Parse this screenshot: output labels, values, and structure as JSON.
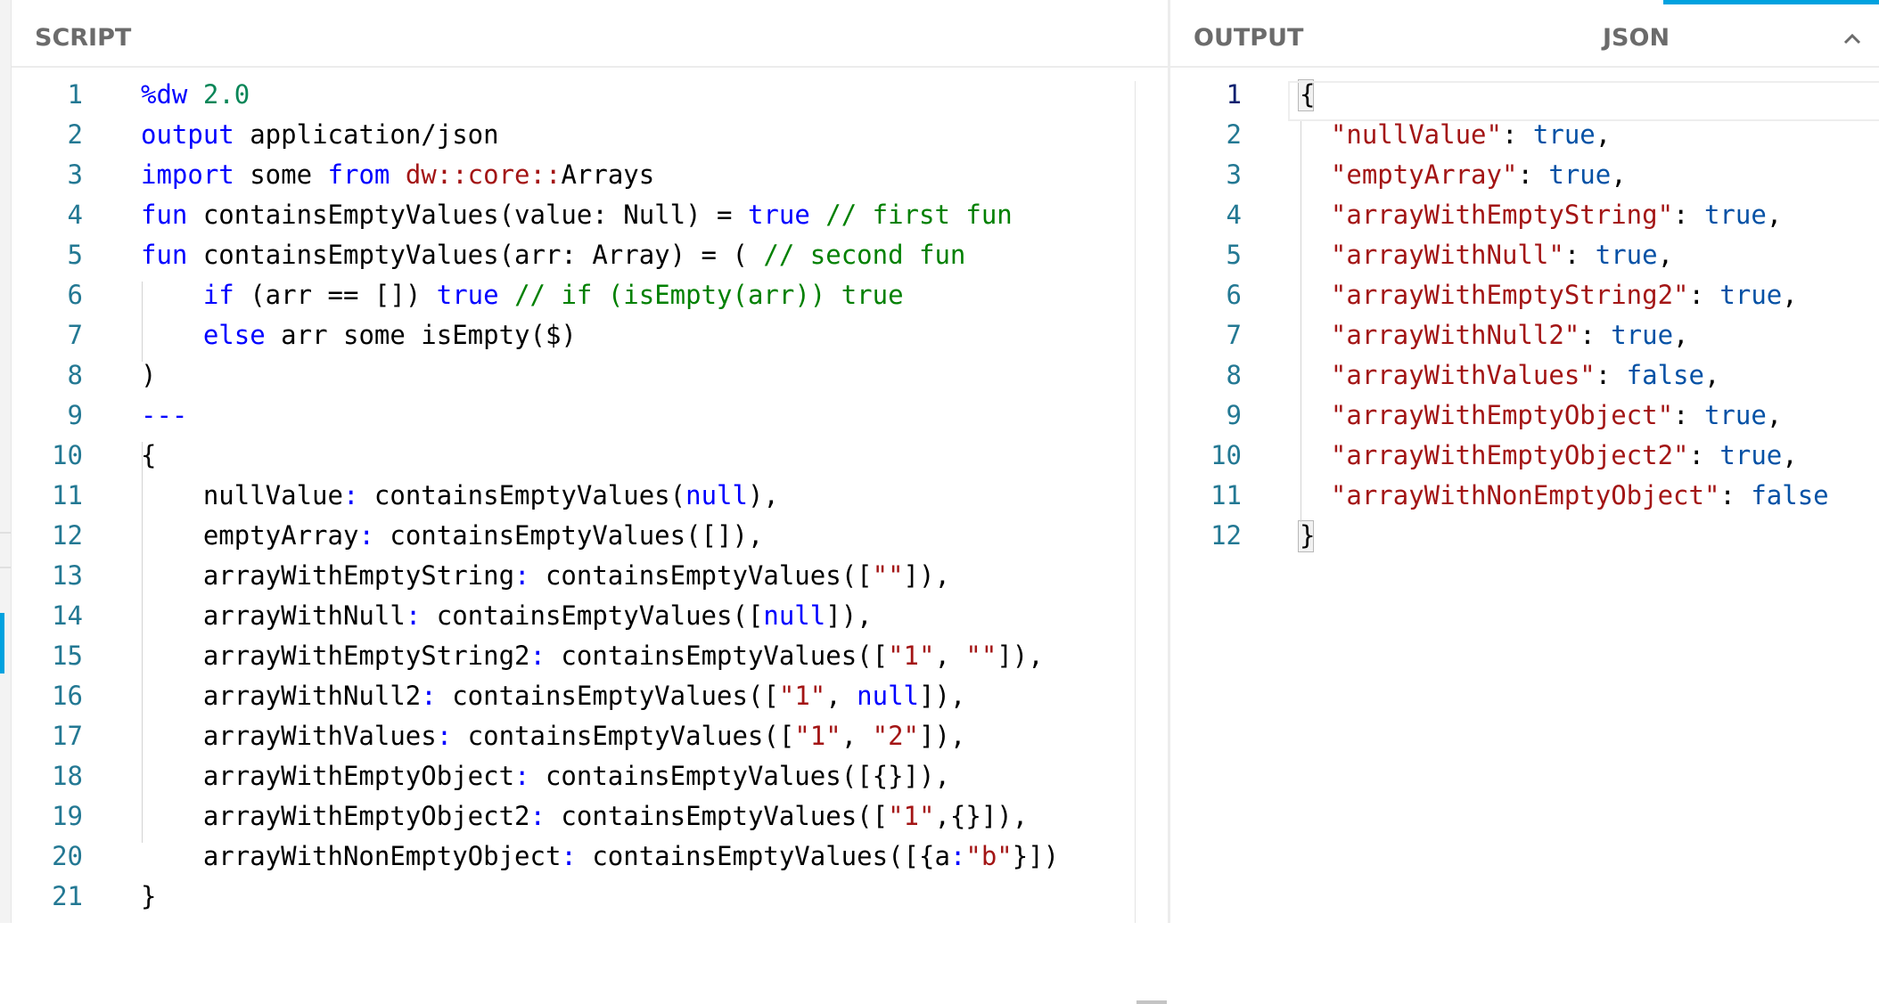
{
  "script_panel": {
    "title": "SCRIPT",
    "lines": [
      {
        "n": "1",
        "segs": [
          [
            "kw",
            "%dw"
          ],
          [
            "",
            " "
          ],
          [
            "num",
            "2.0"
          ]
        ]
      },
      {
        "n": "2",
        "segs": [
          [
            "kw",
            "output"
          ],
          [
            "",
            " application/json"
          ]
        ]
      },
      {
        "n": "3",
        "segs": [
          [
            "kw",
            "import"
          ],
          [
            "",
            " some "
          ],
          [
            "kw",
            "from"
          ],
          [
            "",
            " "
          ],
          [
            "ns",
            "dw::core::"
          ],
          [
            "",
            "Arrays"
          ]
        ]
      },
      {
        "n": "4",
        "segs": [
          [
            "kw",
            "fun"
          ],
          [
            "",
            " containsEmptyValues(value: Null) = "
          ],
          [
            "kw",
            "true"
          ],
          [
            "",
            " "
          ],
          [
            "cm",
            "// first fun"
          ]
        ]
      },
      {
        "n": "5",
        "segs": [
          [
            "kw",
            "fun"
          ],
          [
            "",
            " containsEmptyValues(arr: Array) = ( "
          ],
          [
            "cm",
            "// second fun"
          ]
        ]
      },
      {
        "n": "6",
        "segs": [
          [
            "",
            "    "
          ],
          [
            "kw",
            "if"
          ],
          [
            "",
            " (arr == []) "
          ],
          [
            "kw",
            "true"
          ],
          [
            "",
            " "
          ],
          [
            "cm",
            "// if (isEmpty(arr)) true"
          ]
        ]
      },
      {
        "n": "7",
        "segs": [
          [
            "",
            "    "
          ],
          [
            "kw",
            "else"
          ],
          [
            "",
            " arr some isEmpty($)"
          ]
        ]
      },
      {
        "n": "8",
        "segs": [
          [
            "",
            ")"
          ]
        ]
      },
      {
        "n": "9",
        "segs": [
          [
            "kw",
            "---"
          ]
        ]
      },
      {
        "n": "10",
        "segs": [
          [
            "",
            "{"
          ]
        ]
      },
      {
        "n": "11",
        "segs": [
          [
            "",
            "    nullValue"
          ],
          [
            "sep",
            ":"
          ],
          [
            "",
            " containsEmptyValues("
          ],
          [
            "kw",
            "null"
          ],
          [
            "",
            "),"
          ]
        ]
      },
      {
        "n": "12",
        "segs": [
          [
            "",
            "    emptyArray"
          ],
          [
            "sep",
            ":"
          ],
          [
            "",
            " containsEmptyValues([]),"
          ]
        ]
      },
      {
        "n": "13",
        "segs": [
          [
            "",
            "    arrayWithEmptyString"
          ],
          [
            "sep",
            ":"
          ],
          [
            "",
            " containsEmptyValues(["
          ],
          [
            "str",
            "\"\""
          ],
          [
            "",
            "]),"
          ]
        ]
      },
      {
        "n": "14",
        "segs": [
          [
            "",
            "    arrayWithNull"
          ],
          [
            "sep",
            ":"
          ],
          [
            "",
            " containsEmptyValues(["
          ],
          [
            "kw",
            "null"
          ],
          [
            "",
            "]),"
          ]
        ]
      },
      {
        "n": "15",
        "segs": [
          [
            "",
            "    arrayWithEmptyString2"
          ],
          [
            "sep",
            ":"
          ],
          [
            "",
            " containsEmptyValues(["
          ],
          [
            "str",
            "\"1\""
          ],
          [
            "",
            ", "
          ],
          [
            "str",
            "\"\""
          ],
          [
            "",
            "]),"
          ]
        ]
      },
      {
        "n": "16",
        "segs": [
          [
            "",
            "    arrayWithNull2"
          ],
          [
            "sep",
            ":"
          ],
          [
            "",
            " containsEmptyValues(["
          ],
          [
            "str",
            "\"1\""
          ],
          [
            "",
            ", "
          ],
          [
            "kw",
            "null"
          ],
          [
            "",
            "]),"
          ]
        ]
      },
      {
        "n": "17",
        "segs": [
          [
            "",
            "    arrayWithValues"
          ],
          [
            "sep",
            ":"
          ],
          [
            "",
            " containsEmptyValues(["
          ],
          [
            "str",
            "\"1\""
          ],
          [
            "",
            ", "
          ],
          [
            "str",
            "\"2\""
          ],
          [
            "",
            "]),"
          ]
        ]
      },
      {
        "n": "18",
        "segs": [
          [
            "",
            "    arrayWithEmptyObject"
          ],
          [
            "sep",
            ":"
          ],
          [
            "",
            " containsEmptyValues([{}]),"
          ]
        ]
      },
      {
        "n": "19",
        "segs": [
          [
            "",
            "    arrayWithEmptyObject2"
          ],
          [
            "sep",
            ":"
          ],
          [
            "",
            " containsEmptyValues(["
          ],
          [
            "str",
            "\"1\""
          ],
          [
            "",
            ",{}]),"
          ]
        ]
      },
      {
        "n": "20",
        "segs": [
          [
            "",
            "    arrayWithNonEmptyObject"
          ],
          [
            "sep",
            ":"
          ],
          [
            "",
            " containsEmptyValues([{a"
          ],
          [
            "sep",
            ":"
          ],
          [
            "str",
            "\"b\""
          ],
          [
            "",
            "}])"
          ]
        ]
      },
      {
        "n": "21",
        "segs": [
          [
            "",
            "}"
          ]
        ]
      }
    ]
  },
  "output_panel": {
    "title": "OUTPUT",
    "format": "JSON",
    "lines": [
      {
        "n": "1",
        "segs": [
          [
            "",
            "{"
          ]
        ]
      },
      {
        "n": "2",
        "segs": [
          [
            "",
            "  "
          ],
          [
            "jkey",
            "\"nullValue\""
          ],
          [
            "",
            ": "
          ],
          [
            "jval",
            "true"
          ],
          [
            "",
            ","
          ]
        ]
      },
      {
        "n": "3",
        "segs": [
          [
            "",
            "  "
          ],
          [
            "jkey",
            "\"emptyArray\""
          ],
          [
            "",
            ": "
          ],
          [
            "jval",
            "true"
          ],
          [
            "",
            ","
          ]
        ]
      },
      {
        "n": "4",
        "segs": [
          [
            "",
            "  "
          ],
          [
            "jkey",
            "\"arrayWithEmptyString\""
          ],
          [
            "",
            ": "
          ],
          [
            "jval",
            "true"
          ],
          [
            "",
            ","
          ]
        ]
      },
      {
        "n": "5",
        "segs": [
          [
            "",
            "  "
          ],
          [
            "jkey",
            "\"arrayWithNull\""
          ],
          [
            "",
            ": "
          ],
          [
            "jval",
            "true"
          ],
          [
            "",
            ","
          ]
        ]
      },
      {
        "n": "6",
        "segs": [
          [
            "",
            "  "
          ],
          [
            "jkey",
            "\"arrayWithEmptyString2\""
          ],
          [
            "",
            ": "
          ],
          [
            "jval",
            "true"
          ],
          [
            "",
            ","
          ]
        ]
      },
      {
        "n": "7",
        "segs": [
          [
            "",
            "  "
          ],
          [
            "jkey",
            "\"arrayWithNull2\""
          ],
          [
            "",
            ": "
          ],
          [
            "jval",
            "true"
          ],
          [
            "",
            ","
          ]
        ]
      },
      {
        "n": "8",
        "segs": [
          [
            "",
            "  "
          ],
          [
            "jkey",
            "\"arrayWithValues\""
          ],
          [
            "",
            ": "
          ],
          [
            "jval",
            "false"
          ],
          [
            "",
            ","
          ]
        ]
      },
      {
        "n": "9",
        "segs": [
          [
            "",
            "  "
          ],
          [
            "jkey",
            "\"arrayWithEmptyObject\""
          ],
          [
            "",
            ": "
          ],
          [
            "jval",
            "true"
          ],
          [
            "",
            ","
          ]
        ]
      },
      {
        "n": "10",
        "segs": [
          [
            "",
            "  "
          ],
          [
            "jkey",
            "\"arrayWithEmptyObject2\""
          ],
          [
            "",
            ": "
          ],
          [
            "jval",
            "true"
          ],
          [
            "",
            ","
          ]
        ]
      },
      {
        "n": "11",
        "segs": [
          [
            "",
            "  "
          ],
          [
            "jkey",
            "\"arrayWithNonEmptyObject\""
          ],
          [
            "",
            ": "
          ],
          [
            "jval",
            "false"
          ]
        ]
      },
      {
        "n": "12",
        "segs": [
          [
            "",
            "}"
          ]
        ]
      }
    ]
  },
  "icons": {
    "format_dropdown": "chevron-up-icon"
  }
}
